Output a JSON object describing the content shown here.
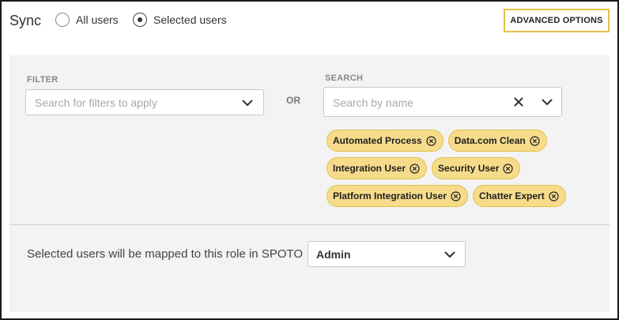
{
  "header": {
    "title": "Sync",
    "options": [
      {
        "label": "All users",
        "checked": false
      },
      {
        "label": "Selected users",
        "checked": true
      }
    ],
    "advanced_button": "ADVANCED OPTIONS"
  },
  "filter": {
    "label": "FILTER",
    "placeholder": "Search for filters to apply"
  },
  "or_text": "OR",
  "search": {
    "label": "SEARCH",
    "placeholder": "Search by name",
    "chips": [
      [
        "Automated Process",
        "Data.com Clean"
      ],
      [
        "Integration User",
        "Security User"
      ],
      [
        "Platform Integration User",
        "Chatter Expert"
      ]
    ]
  },
  "mapping": {
    "text": "Selected users will be mapped to this role in SPOTO",
    "selected_role": "Admin"
  },
  "colors": {
    "chip_fill": "#f6dc8a",
    "chip_border": "#e5c04c",
    "accent_border": "#e4c04a",
    "panel_bg": "#f3f3f3"
  }
}
